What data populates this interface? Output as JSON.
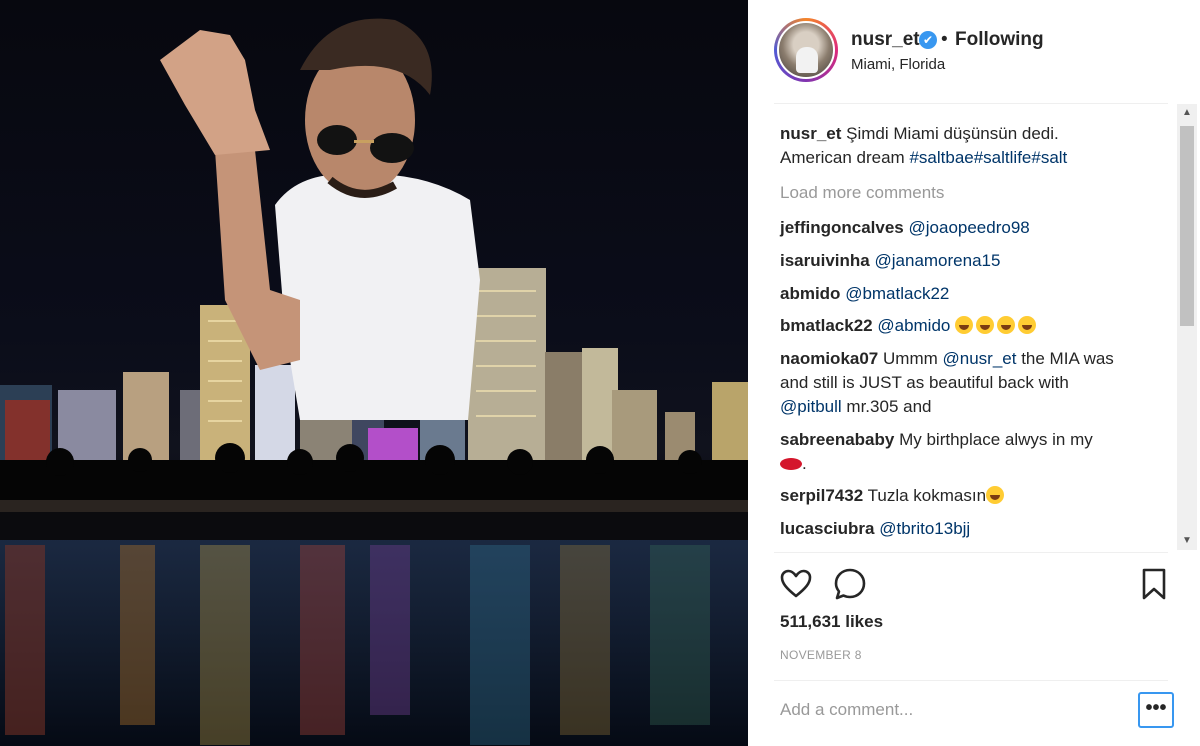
{
  "header": {
    "username": "nusr_et",
    "verified_icon": "✔",
    "separator": "•",
    "follow_status": "Following",
    "location": "Miami, Florida"
  },
  "caption": {
    "user": "nusr_et",
    "line1": "Şimdi Miami düşünsün dedi.",
    "line2_text": "American dream",
    "hashtags": "#saltbae#saltlife#salt"
  },
  "load_more": "Load more comments",
  "comments": [
    {
      "user": "jeffingoncalves",
      "mention": "@joaopeedro98"
    },
    {
      "user": "isaruivinha",
      "mention": "@janamorena15"
    },
    {
      "user": "abmido",
      "mention": "@bmatlack22"
    },
    {
      "user": "bmatlack22",
      "mention": "@abmido"
    },
    {
      "user": "naomioka07",
      "text_a": "Ummm",
      "mention": "@nusr_et",
      "text_b": "the MIA was",
      "line2": "and still is JUST as beautiful back with",
      "mention2": "@pitbull",
      "text_c": "mr.305 and"
    },
    {
      "user": "sabreenababy",
      "text": "My birthplace alwys in my",
      "line2": "."
    },
    {
      "user": "serpil7432",
      "text": "Tuzla kokmasın"
    },
    {
      "user": "lucasciubra",
      "mention": "@tbrito13bjj"
    }
  ],
  "likes": "511,631 likes",
  "date": "NOVEMBER 8",
  "add_comment_placeholder": "Add a comment...",
  "more_button": "•••",
  "colors": {
    "link": "#003569",
    "verified": "#3897f0",
    "muted": "#999999"
  }
}
